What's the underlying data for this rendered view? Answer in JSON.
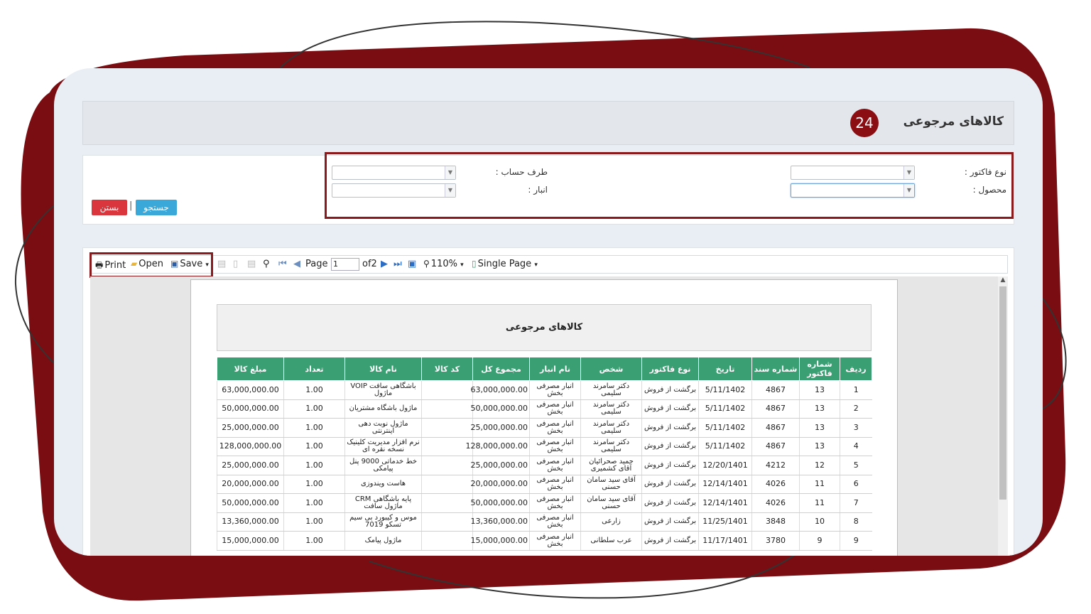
{
  "page": {
    "title": "کالاهای مرجوعی",
    "badge": "24"
  },
  "filters": {
    "invoice_type_label": "نوع فاکتور :",
    "product_label": "محصول :",
    "account_label": "طرف حساب :",
    "warehouse_label": "انبار :",
    "invoice_type_value": "",
    "product_value": "",
    "account_value": "",
    "warehouse_value": "",
    "search_button": "جستجو",
    "close_button": "بستن",
    "separator": "|"
  },
  "toolbar": {
    "print": "Print",
    "open": "Open",
    "save": "Save",
    "page_label": "Page",
    "page_value": "1",
    "of_pages": "of2",
    "zoom": "110%",
    "view_mode": "Single Page"
  },
  "report": {
    "title": "کالاهای مرجوعی",
    "columns": [
      "ردیف",
      "شماره فاکتور",
      "شماره سند",
      "تاریخ",
      "نوع فاکتور",
      "شخص",
      "نام انبار",
      "مجموع کل",
      "کد کالا",
      "نام کالا",
      "تعداد",
      "مبلغ کالا"
    ],
    "rows": [
      [
        "1",
        "13",
        "4867",
        "5/11/1402",
        "برگشت از فروش",
        "دکتر سامرند سلیمی",
        "انبار مصرفی بخش",
        "63,000,000.00",
        "",
        "باشگاهی سافت VOIP ماژول",
        "1.00",
        "63,000,000.00"
      ],
      [
        "2",
        "13",
        "4867",
        "5/11/1402",
        "برگشت از فروش",
        "دکتر سامرند سلیمی",
        "انبار مصرفی بخش",
        "50,000,000.00",
        "",
        "ماژول باشگاه مشتریان",
        "1.00",
        "50,000,000.00"
      ],
      [
        "3",
        "13",
        "4867",
        "5/11/1402",
        "برگشت از فروش",
        "دکتر سامرند سلیمی",
        "انبار مصرفی بخش",
        "25,000,000.00",
        "",
        "ماژول نوبت دهی اینترنتی",
        "1.00",
        "25,000,000.00"
      ],
      [
        "4",
        "13",
        "4867",
        "5/11/1402",
        "برگشت از فروش",
        "دکتر سامرند سلیمی",
        "انبار مصرفی بخش",
        "128,000,000.00",
        "",
        "نرم افزار مدیریت کلینیک نسخه نقره ای",
        "1.00",
        "128,000,000.00"
      ],
      [
        "5",
        "12",
        "4212",
        "12/20/1401",
        "برگشت از فروش",
        "حمید صحرائیان آقای کشمیری",
        "انبار مصرفی بخش",
        "25,000,000.00",
        "",
        "خط خدماتی 9000 پنل پیامکی",
        "1.00",
        "25,000,000.00"
      ],
      [
        "6",
        "11",
        "4026",
        "12/14/1401",
        "برگشت از فروش",
        "آقای سید سامان حسنی",
        "انبار مصرفی بخش",
        "20,000,000.00",
        "",
        "هاست ویندوزی",
        "1.00",
        "20,000,000.00"
      ],
      [
        "7",
        "11",
        "4026",
        "12/14/1401",
        "برگشت از فروش",
        "آقای سید سامان حسنی",
        "انبار مصرفی بخش",
        "50,000,000.00",
        "",
        "پایه باشگاهی CRM ماژول سافت",
        "1.00",
        "50,000,000.00"
      ],
      [
        "8",
        "10",
        "3848",
        "11/25/1401",
        "برگشت از فروش",
        "زارعی",
        "انبار مصرفی بخش",
        "13,360,000.00",
        "",
        "موس و کیبورد بی سیم تسکو 7019",
        "1.00",
        "13,360,000.00"
      ],
      [
        "9",
        "9",
        "3780",
        "11/17/1401",
        "برگشت از فروش",
        "عرب سلطانی",
        "انبار مصرفی بخش",
        "15,000,000.00",
        "",
        "ماژول پیامک",
        "1.00",
        "15,000,000.00"
      ]
    ]
  },
  "colors": {
    "brand": "#8b0e12",
    "table_header": "#3a9f73",
    "search_button": "#3aa8d8",
    "close_button": "#d9363e"
  }
}
